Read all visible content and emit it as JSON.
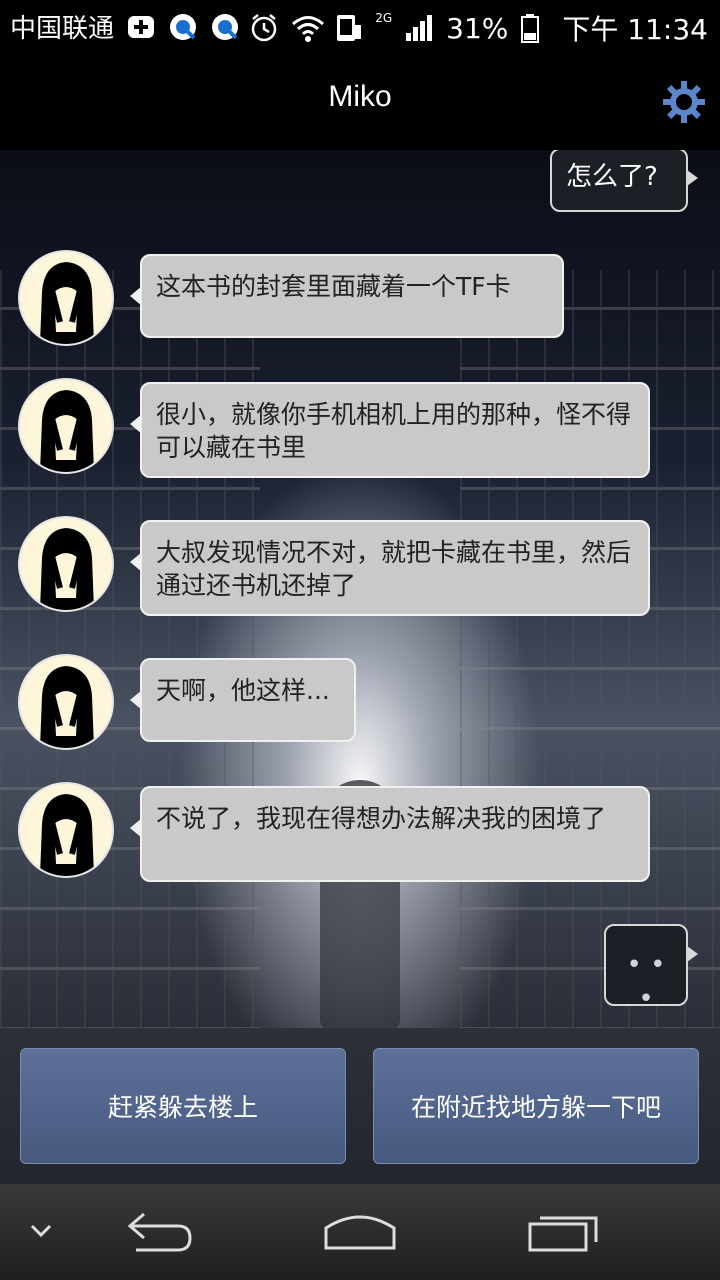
{
  "status_bar": {
    "carrier": "中国联通",
    "network": "2G",
    "battery": "31%",
    "time": "下午 11:34",
    "icons": [
      "plus-icon",
      "qq-icon",
      "qq-icon",
      "alarm-icon",
      "wifi-icon",
      "phone-icon",
      "signal-icon",
      "battery-icon"
    ]
  },
  "header": {
    "title": "Miko",
    "settings_icon": "gear-icon"
  },
  "chat": {
    "outgoing": [
      {
        "text": "怎么了?"
      }
    ],
    "incoming": [
      {
        "text": "这本书的封套里面藏着一个TF卡"
      },
      {
        "text": "很小，就像你手机相机上用的那种，怪不得可以藏在书里"
      },
      {
        "text": "大叔发现情况不对，就把卡藏在书里，然后通过还书机还掉了"
      },
      {
        "text": "天啊，他这样..."
      },
      {
        "text": "不说了，我现在得想办法解决我的困境了"
      }
    ],
    "typing": "• • •"
  },
  "choices": [
    {
      "label": "赶紧躲去楼上"
    },
    {
      "label": "在附近找地方躲一下吧"
    }
  ],
  "colors": {
    "choice_bg": "#5d7098",
    "bubble_in": "#c9c9c9",
    "bubble_out": "#1c1f26"
  }
}
